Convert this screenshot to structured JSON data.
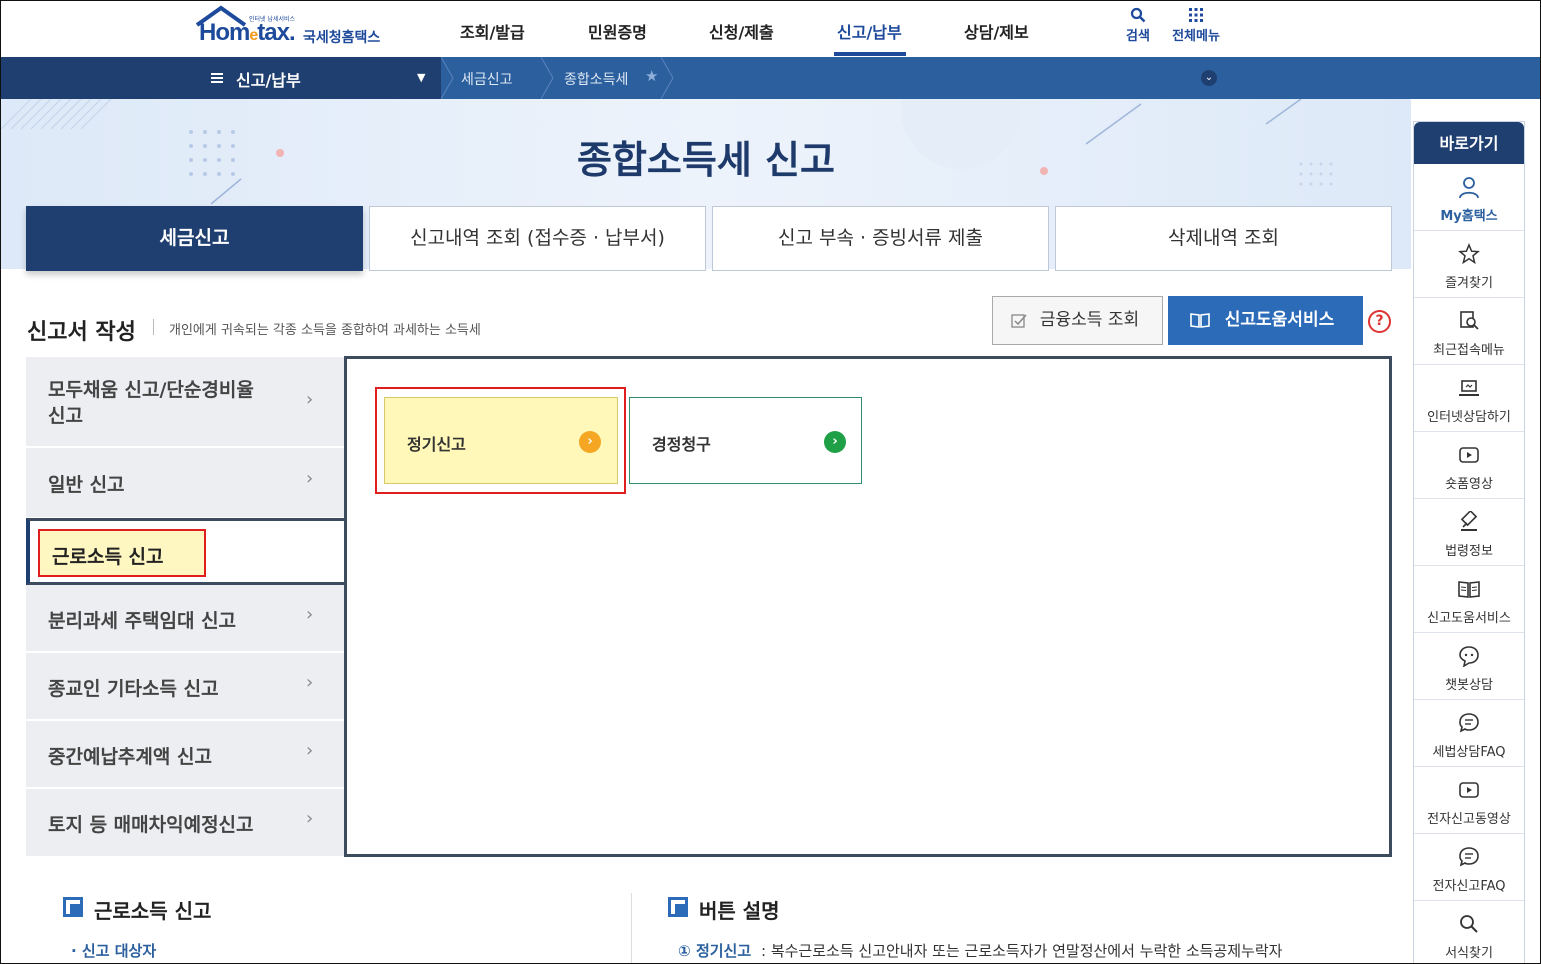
{
  "header": {
    "logo_small": "인터넷 납세서비스",
    "logo_word_1": "Hom",
    "logo_word_e": "e",
    "logo_word_2": "tax.",
    "logo_kor": "국세청홈택스",
    "gnb": [
      "조회/발급",
      "민원증명",
      "신청/제출",
      "신고/납부",
      "상담/제보"
    ],
    "active_gnb": "신고/납부",
    "search_label": "검색",
    "all_menu_label": "전체메뉴"
  },
  "navbar": {
    "title": "신고/납부",
    "crumb_1": "세금신고",
    "crumb_2": "종합소득세"
  },
  "banner": {
    "title": "종합소득세 신고"
  },
  "tabs": [
    "세금신고",
    "신고내역 조회 (접수증 · 납부서)",
    "신고 부속 · 증빙서류 제출",
    "삭제내역 조회"
  ],
  "section": {
    "title": "신고서 작성",
    "desc": "개인에게 귀속되는 각종 소득을 종합하여 과세하는 소득세",
    "btn_financial": "금융소득 조회",
    "btn_help": "신고도움서비스",
    "help_q": "?"
  },
  "left_menu": {
    "items": [
      "모두채움 신고/단순경비율 신고",
      "일반 신고",
      "근로소득 신고",
      "분리과세 주택임대 신고",
      "종교인 기타소득 신고",
      "중간예납추계액 신고",
      "토지 등 매매차익예정신고"
    ],
    "item0_line1": "모두채움 신고/단순경비율",
    "item0_line2": "신고"
  },
  "cards": {
    "regular": "정기신고",
    "correction": "경정청구"
  },
  "bottom": {
    "left_title": "근로소득 신고",
    "left_sub": "신고 대상자",
    "right_title": "버튼 설명",
    "right_num": "①",
    "right_sub": "정기신고",
    "right_text": ": 복수근로소득 신고안내자 또는 근로소득자가 연말정산에서 누락한 소득공제누락자"
  },
  "quick_menu": {
    "head": "바로가기",
    "items": [
      "My홈택스",
      "즐겨찾기",
      "최근접속메뉴",
      "인터넷상담하기",
      "숏폼영상",
      "법령정보",
      "신고도움서비스",
      "챗봇상담",
      "세법상담FAQ",
      "전자신고동영상",
      "전자신고FAQ",
      "서식찾기"
    ]
  },
  "colors": {
    "primary": "#1f3f70",
    "accent": "#2b6bb8",
    "highlight": "#fff8b8",
    "red": "#e01e1e",
    "green": "#1fa046",
    "orange": "#f5a623"
  }
}
